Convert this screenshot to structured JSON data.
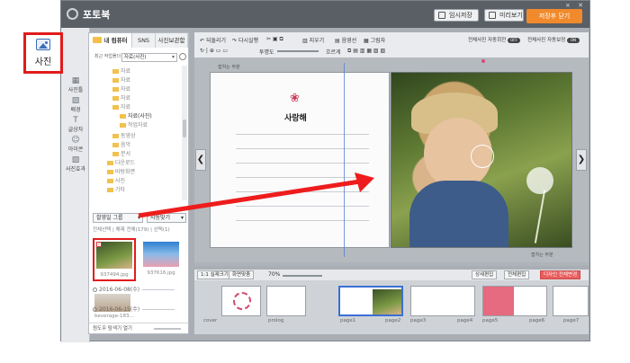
{
  "app": {
    "title": "포토북",
    "window_controls": "⨯ ✕",
    "buttons": {
      "temp_save": "임시저장",
      "preview": "미리보기",
      "save_close": "저장후 닫기"
    }
  },
  "rail": {
    "items": [
      {
        "label": "사진틀"
      },
      {
        "label": "배경"
      },
      {
        "label": "글상자"
      },
      {
        "label": "아이콘"
      },
      {
        "label": "사진효과"
      }
    ]
  },
  "callout": {
    "label": "사진"
  },
  "panel": {
    "tabs": [
      "내 컴퓨터",
      "SNS",
      "사진보관함"
    ],
    "recent_label": "최근 작업폴더",
    "recent_value": "자료(사진)",
    "tree": [
      "자료",
      "자료",
      "자료",
      "자료",
      "자료",
      "자료(사진)",
      "작업자료",
      "동영상",
      "음악",
      "문서",
      "다운로드",
      "바탕화면",
      "사진",
      "기타"
    ],
    "sort_select": "촬영일 그룹",
    "auto_select": "자동맞기",
    "count_text": "전체선택 | 해제      전체(179) | 선택(1)",
    "thumb1_caption": "937494.jpg",
    "thumb2_caption": "937616.jpg",
    "date1": "2016-06-08(수)",
    "thumb3_caption": "beverage-183...",
    "date2": "2016-06-15(수)",
    "bottom_hint": "원도우 탐색기 열기"
  },
  "toolbar": {
    "undo": "되돌리기",
    "redo": "다시실행",
    "opacity": "투명도",
    "distance": "흐르게",
    "delete": "지우기",
    "shadow": "음영선",
    "grid": "그림자",
    "full_auto": "전체사진 자동회전",
    "full_auto_toggle": "OFF",
    "auto_correct": "전체사진 자동보정",
    "auto_correct_toggle": "ON"
  },
  "canvas": {
    "fold_left": "접히는 부분",
    "fold_right": "접히는 부분",
    "logo_text": "사랑해",
    "logo_heart": "❀"
  },
  "filmstrip": {
    "real_size": "1:1 실제크기",
    "fit_screen": "화면맞춤",
    "zoom": "70%",
    "detail_edit": "상세편집",
    "all_edit": "전체편집",
    "design_all": "디자인 전체변경",
    "pages": [
      "cover",
      "prolog",
      "page1",
      "page2",
      "page3",
      "page4",
      "page5",
      "page6",
      "page7"
    ]
  }
}
